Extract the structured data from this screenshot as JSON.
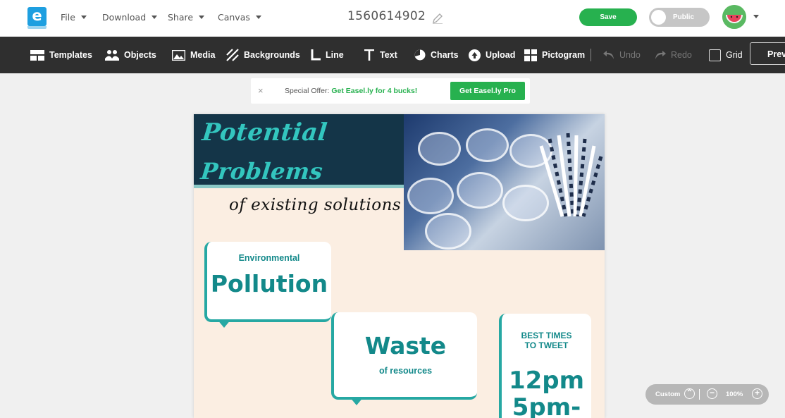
{
  "menu": {
    "items": [
      {
        "label": "File"
      },
      {
        "label": "Download"
      },
      {
        "label": "Share"
      },
      {
        "label": "Canvas"
      }
    ]
  },
  "document": {
    "title": "1560614902"
  },
  "header": {
    "save_label": "Save",
    "public_label": "Public"
  },
  "toolbar": {
    "templates": "Templates",
    "objects": "Objects",
    "media": "Media",
    "backgrounds": "Backgrounds",
    "line": "Line",
    "text": "Text",
    "charts": "Charts",
    "upload": "Upload",
    "pictogram": "Pictogram",
    "undo": "Undo",
    "redo": "Redo",
    "grid": "Grid",
    "preview": "Prev"
  },
  "offer": {
    "close": "×",
    "prefix": "Special Offer:",
    "highlight": "Get Easel.ly for 4 bucks!",
    "cta": "Get Easel.ly Pro"
  },
  "canvas": {
    "title_line1": "Potential",
    "title_line2": "Problems",
    "subtitle": "of existing solutions",
    "bubble1": {
      "small": "Environmental",
      "big": "Pollution"
    },
    "bubble2": {
      "big": "Waste",
      "small": "of resources"
    },
    "bubble3": {
      "small_line1": "BEST TIMES",
      "small_line2": "TO TWEET",
      "big_line1": "12pm",
      "big_line2": "5pm-"
    }
  },
  "zoom": {
    "mode": "Custom",
    "level": "100%"
  },
  "colors": {
    "accent_green": "#27b14f",
    "toolbar_dark": "#2f2f2f",
    "teal": "#26a8a3",
    "navy": "#143548",
    "canvas_bg": "#fbeee2"
  }
}
